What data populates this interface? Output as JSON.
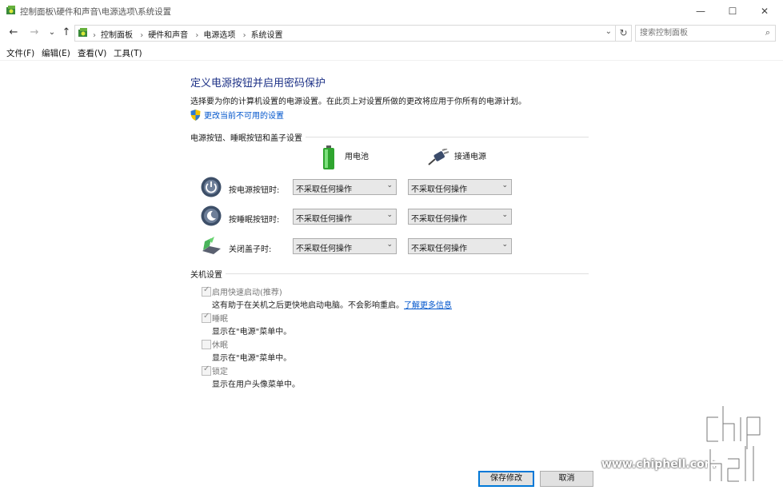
{
  "window": {
    "title": "控制面板\\硬件和声音\\电源选项\\系统设置",
    "minimize_glyph": "—",
    "maximize_glyph": "☐",
    "close_glyph": "✕"
  },
  "nav": {
    "back": "←",
    "forward": "→",
    "recent": "⌄",
    "up": "↑",
    "breadcrumbs": [
      "控制面板",
      "硬件和声音",
      "电源选项",
      "系统设置"
    ],
    "sep": "›",
    "address_dropdown": "⌄",
    "refresh": "↻",
    "search_placeholder": "搜索控制面板",
    "search_icon": "⌕"
  },
  "menu": [
    "文件(F)",
    "编辑(E)",
    "查看(V)",
    "工具(T)"
  ],
  "main": {
    "heading": "定义电源按钮并启用密码保护",
    "description": "选择要为你的计算机设置的电源设置。在此页上对设置所做的更改将应用于你所有的电源计划。",
    "change_link": "更改当前不可用的设置",
    "buttons_section": "电源按钮、睡眠按钮和盖子设置",
    "col_battery": "用电池",
    "col_plugged": "接通电源",
    "rows": [
      {
        "label": "按电源按钮时:",
        "battery": "不采取任何操作",
        "plugged": "不采取任何操作",
        "icon": "power-button-icon"
      },
      {
        "label": "按睡眠按钮时:",
        "battery": "不采取任何操作",
        "plugged": "不采取任何操作",
        "icon": "sleep-button-icon"
      },
      {
        "label": "关闭盖子时:",
        "battery": "不采取任何操作",
        "plugged": "不采取任何操作",
        "icon": "laptop-lid-icon"
      }
    ],
    "combo_arrow": "⌄",
    "shutdown_section": "关机设置",
    "shutdown": [
      {
        "label": "启用快速启动(推荐)",
        "desc": "这有助于在关机之后更快地启动电脑。不会影响重启。",
        "link": "了解更多信息",
        "checked": true
      },
      {
        "label": "睡眠",
        "desc": "显示在\"电源\"菜单中。",
        "checked": true
      },
      {
        "label": "休眠",
        "desc": "显示在\"电源\"菜单中。",
        "checked": false
      },
      {
        "label": "锁定",
        "desc": "显示在用户头像菜单中。",
        "checked": true
      }
    ]
  },
  "footer": {
    "save": "保存修改",
    "cancel": "取消"
  },
  "watermark": {
    "url": "www.chiphell.com",
    "logo": "chip hell"
  },
  "colors": {
    "heading": "#1e3287",
    "link": "#0055cc",
    "focus": "#0078d7"
  }
}
